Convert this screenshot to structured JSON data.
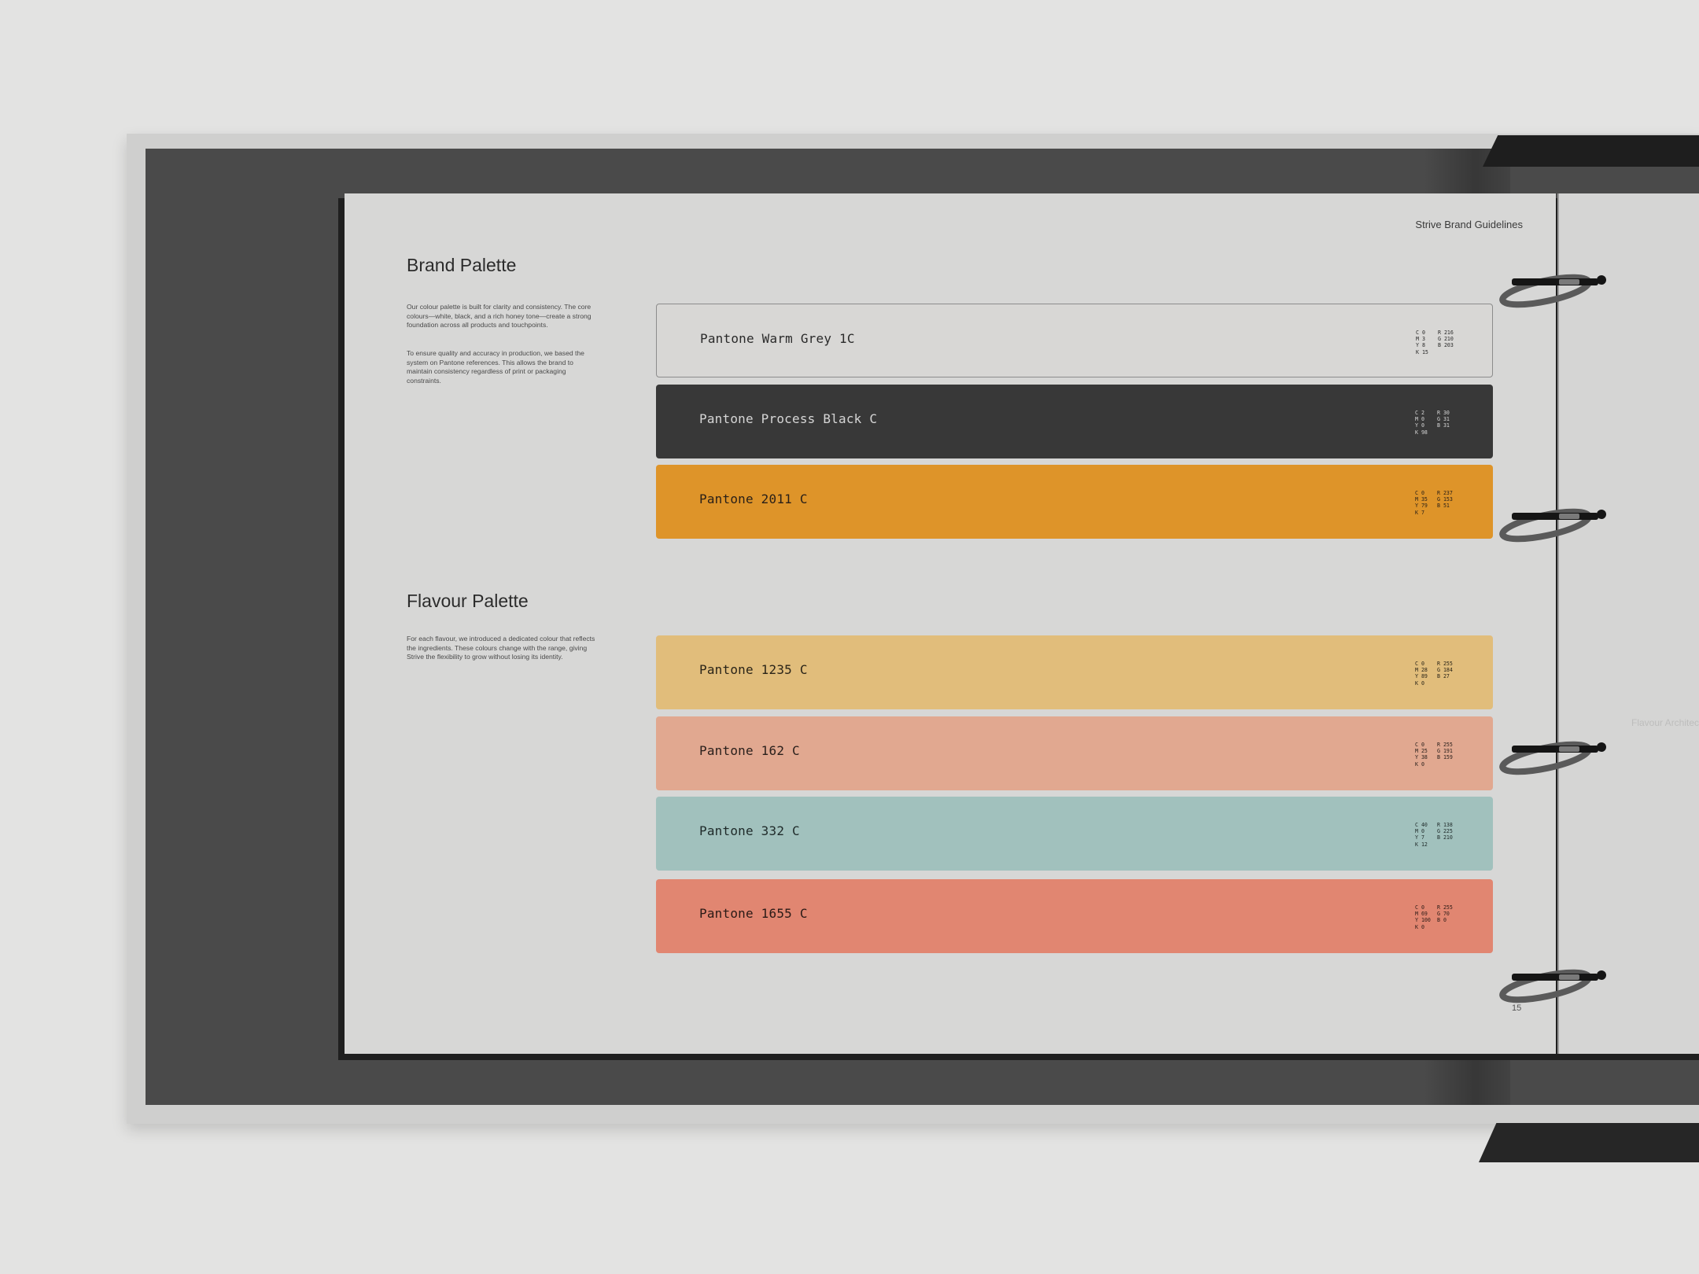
{
  "document": {
    "header_title": "Strive Brand Guidelines",
    "page_number": "15",
    "next_page_text": "Flavour Architecture"
  },
  "brand_palette": {
    "heading": "Brand Palette",
    "paragraph_1": "Our colour palette is built for clarity and consistency. The core colours—white, black, and a rich honey tone—create a strong foundation across all products and touchpoints.",
    "paragraph_2": "To ensure quality and accuracy in production, we based the system on Pantone references. This allows the brand to maintain consistency regardless of print or packaging constraints.",
    "swatches": [
      {
        "name": "Pantone Warm Grey 1C",
        "cmyk": [
          "C 0",
          "M 3",
          "Y 8",
          "K 15"
        ],
        "rgb": [
          "R 216",
          "G 210",
          "B 203"
        ],
        "color": "#d8d7d5",
        "text_color": "#2a2a2a",
        "outlined": true
      },
      {
        "name": "Pantone Process Black C",
        "cmyk": [
          "C 2",
          "M 0",
          "Y 0",
          "K 98"
        ],
        "rgb": [
          "R 30",
          "G 31",
          "B 31"
        ],
        "color": "#383838",
        "text_color": "#d6d6d6",
        "outlined": false
      },
      {
        "name": "Pantone 2011 C",
        "cmyk": [
          "C 0",
          "M 35",
          "Y 79",
          "K 7"
        ],
        "rgb": [
          "R 237",
          "G 153",
          "B 51"
        ],
        "color": "#de9429",
        "text_color": "#2a2018",
        "outlined": false
      }
    ]
  },
  "flavour_palette": {
    "heading": "Flavour Palette",
    "paragraph": "For each flavour, we introduced a dedicated colour that reflects the ingredients. These colours change with the range, giving Strive the flexibility to grow without losing its identity.",
    "swatches": [
      {
        "name": "Pantone 1235 C",
        "cmyk": [
          "C 0",
          "M 28",
          "Y 89",
          "K 0"
        ],
        "rgb": [
          "R 255",
          "G 184",
          "B 27"
        ],
        "color": "#e1bd7b",
        "text_color": "#2a2418",
        "outlined": false
      },
      {
        "name": "Pantone 162 C",
        "cmyk": [
          "C 0",
          "M 25",
          "Y 38",
          "K 0"
        ],
        "rgb": [
          "R 255",
          "G 191",
          "B 159"
        ],
        "color": "#e1a890",
        "text_color": "#2a201c",
        "outlined": false
      },
      {
        "name": "Pantone 332 C",
        "cmyk": [
          "C 40",
          "M 0",
          "Y 7",
          "K 12"
        ],
        "rgb": [
          "R 138",
          "G 225",
          "B 210"
        ],
        "color": "#a1c1bd",
        "text_color": "#1f2a29",
        "outlined": false
      },
      {
        "name": "Pantone 1655 C",
        "cmyk": [
          "C 0",
          "M 69",
          "Y 100",
          "K 0"
        ],
        "rgb": [
          "R 255",
          "G 70",
          "B 0"
        ],
        "color": "#e18671",
        "text_color": "#2a1a16",
        "outlined": false
      }
    ]
  }
}
